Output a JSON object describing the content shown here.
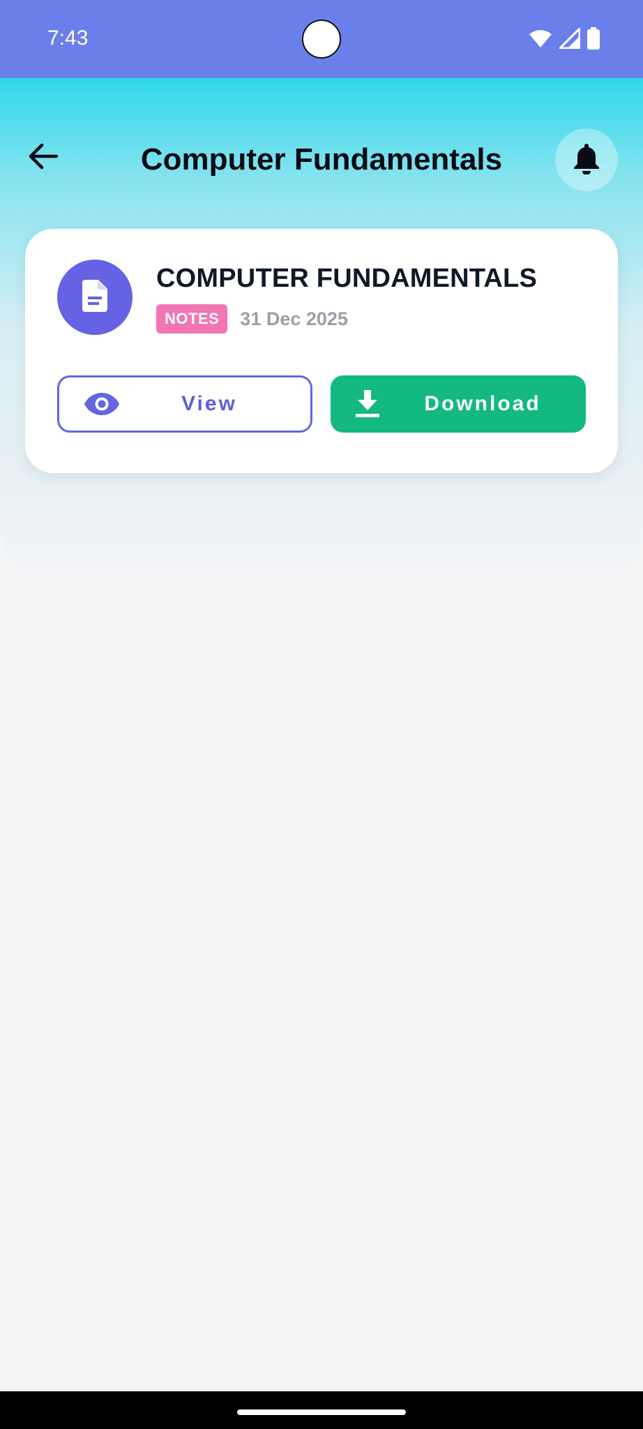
{
  "status_bar": {
    "time": "7:43",
    "icons": [
      "wifi-icon",
      "signal-icon",
      "battery-icon"
    ],
    "background": "#6b7fea"
  },
  "app_bar": {
    "title": "Computer Fundamentals",
    "back_icon": "arrow-left-icon",
    "notification_icon": "bell-icon"
  },
  "card": {
    "title": "COMPUTER FUNDAMENTALS",
    "badge": "NOTES",
    "date": "31 Dec 2025",
    "file_icon": "document-icon",
    "view_label": "View",
    "view_icon": "eye-icon",
    "download_label": "Download",
    "download_icon": "download-icon"
  },
  "colors": {
    "accent": "#6366e0",
    "download": "#13b97f",
    "badge": "#f176b3",
    "header_gradient_top": "#2fd8ea"
  }
}
